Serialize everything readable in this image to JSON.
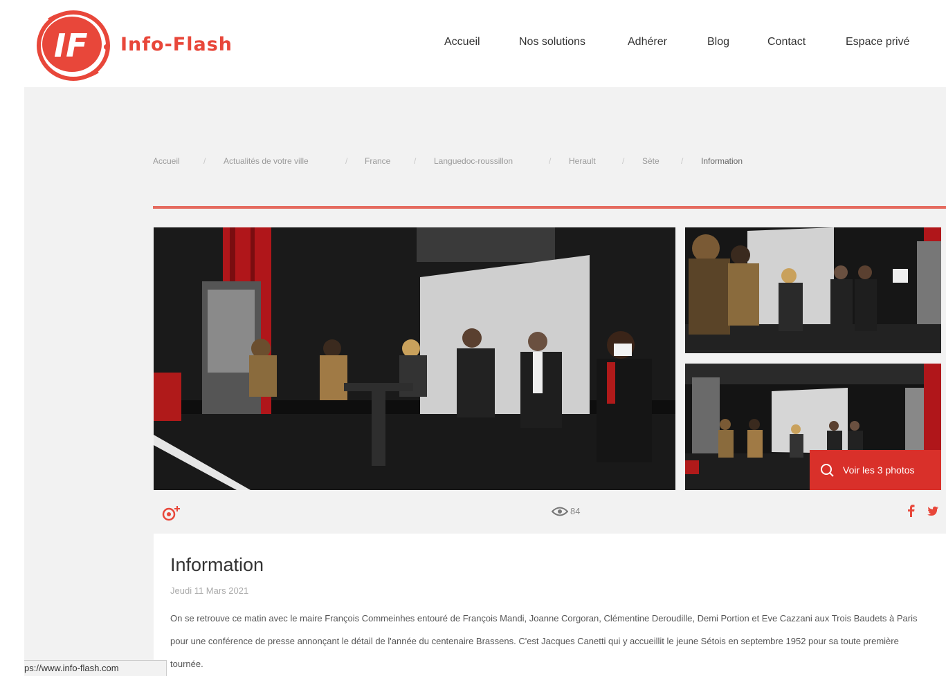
{
  "brand": {
    "name": "Info-Flash",
    "logo_letters": "IF",
    "accent_color": "#e8473a"
  },
  "nav": {
    "items": [
      {
        "label": "Accueil"
      },
      {
        "label": "Nos solutions"
      },
      {
        "label": "Adhérer"
      },
      {
        "label": "Blog"
      },
      {
        "label": "Contact"
      },
      {
        "label": "Espace privé"
      }
    ]
  },
  "breadcrumb": {
    "items": [
      "Accueil",
      "Actualités de votre ville",
      "France",
      "Languedoc-roussillon",
      "Herault",
      "Sète",
      "Information"
    ],
    "separator": "/"
  },
  "gallery": {
    "view_all_label": "Voir les 3 photos",
    "view_all_icon": "search-icon"
  },
  "actions": {
    "add_icon": "add-follow-icon",
    "views_icon": "eye-icon",
    "views_count": "84",
    "share": [
      "facebook-icon",
      "twitter-icon"
    ]
  },
  "article": {
    "title": "Information",
    "date": "Jeudi 11 Mars 2021",
    "body": "On se retrouve ce matin avec le maire François Commeinhes entouré de François Mandi, Joanne Corgoran, Clémentine Deroudille, Demi Portion et Eve Cazzani aux Trois Baudets à Paris pour une conférence de presse annonçant le détail de l'année du centenaire Brassens. C'est Jacques Canetti qui y accueillit le jeune Sétois en septembre 1952 pour sa toute première tournée."
  },
  "status_bar": {
    "url": "ps://www.info-flash.com"
  }
}
